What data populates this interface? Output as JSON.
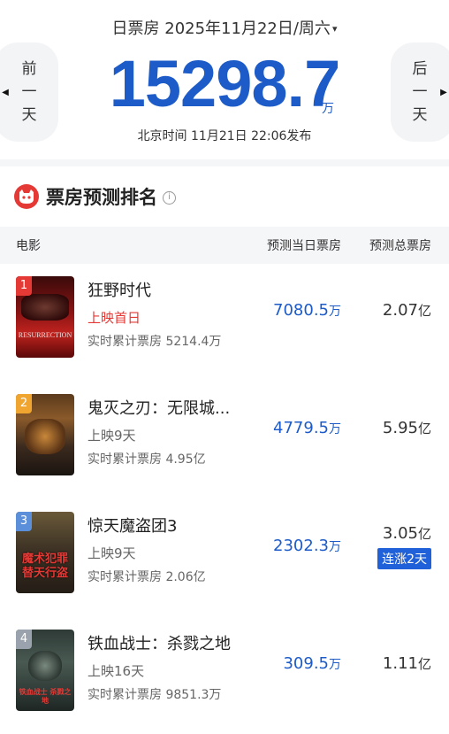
{
  "header": {
    "date_label": "日票房 2025年11月22日/周六",
    "caret": "▾",
    "prev_label": "前一天",
    "next_label": "后一天",
    "total": "15298.7",
    "unit": "万",
    "publish_time": "北京时间  11月21日  22:06发布"
  },
  "section": {
    "title": "票房预测排名",
    "info_icon": "i"
  },
  "columns": {
    "movie": "电影",
    "today": "预测当日票房",
    "total": "预测总票房"
  },
  "movies": [
    {
      "rank": "1",
      "title": "狂野时代",
      "status": "上映首日",
      "cumulative": "实时累计票房 5214.4万",
      "today_value": "7080.5",
      "today_unit": "万",
      "total_value": "2.07",
      "total_unit": "亿",
      "poster_text": "RESURRECTION"
    },
    {
      "rank": "2",
      "title": "鬼灭之刃：无限城...",
      "status": "上映9天",
      "cumulative": "实时累计票房 4.95亿",
      "today_value": "4779.5",
      "today_unit": "万",
      "total_value": "5.95",
      "total_unit": "亿",
      "poster_text": ""
    },
    {
      "rank": "3",
      "title": "惊天魔盗团3",
      "status": "上映9天",
      "cumulative": "实时累计票房 2.06亿",
      "today_value": "2302.3",
      "today_unit": "万",
      "total_value": "3.05",
      "total_unit": "亿",
      "badge": "连涨2天",
      "poster_text": "魔术犯罪 替天行盗"
    },
    {
      "rank": "4",
      "title": "铁血战士：杀戮之地",
      "status": "上映16天",
      "cumulative": "实时累计票房 9851.3万",
      "today_value": "309.5",
      "today_unit": "万",
      "total_value": "1.11",
      "total_unit": "亿",
      "poster_text": "铁血战士 杀戮之地"
    }
  ],
  "colors": {
    "accent_blue": "#1c5bc8",
    "red": "#e53935",
    "badge_blue": "#2060d8"
  }
}
